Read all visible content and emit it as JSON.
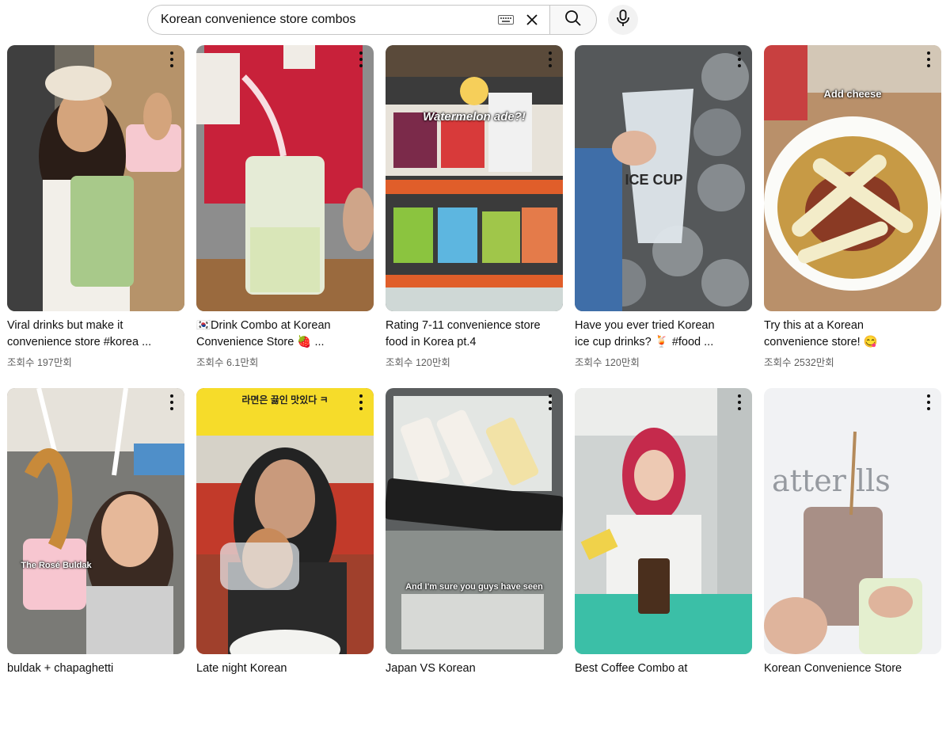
{
  "search": {
    "query": "Korean convenience store combos",
    "placeholder": "Search"
  },
  "icons": {
    "keyboard": "keyboard-icon",
    "clear": "close-icon",
    "search": "search-icon",
    "mic": "microphone-icon",
    "more": "more-vertical-icon"
  },
  "videos": [
    {
      "title": "Viral drinks but make it convenience store #korea ...",
      "views": "조회수 197만회",
      "overlay": ""
    },
    {
      "title": "🇰🇷Drink Combo at Korean Convenience Store 🍓 ...",
      "views": "조회수 6.1만회",
      "overlay": ""
    },
    {
      "title": "Rating 7-11 convenience store food in Korea pt.4",
      "views": "조회수 120만회",
      "overlay": "Watermelon ade?!"
    },
    {
      "title": "Have you ever tried Korean ice cup drinks? 🍹 #food ...",
      "views": "조회수 120만회",
      "overlay": "ICE CUP"
    },
    {
      "title": "Try this at a Korean convenience store! 😋",
      "views": "조회수 2532만회",
      "overlay": "Add cheese"
    },
    {
      "title": "buldak + chapaghetti",
      "views": "",
      "overlay": "The Rosé Buldak"
    },
    {
      "title": "Late night Korean",
      "views": "",
      "overlay": "라면은 끓인 맛있다 ㅋ"
    },
    {
      "title": "Japan VS Korean",
      "views": "",
      "overlay": "And I'm sure you guys have seen"
    },
    {
      "title": "Best Coffee Combo at",
      "views": "",
      "overlay": ""
    },
    {
      "title": "Korean Convenience Store",
      "views": "",
      "overlay": ""
    }
  ]
}
